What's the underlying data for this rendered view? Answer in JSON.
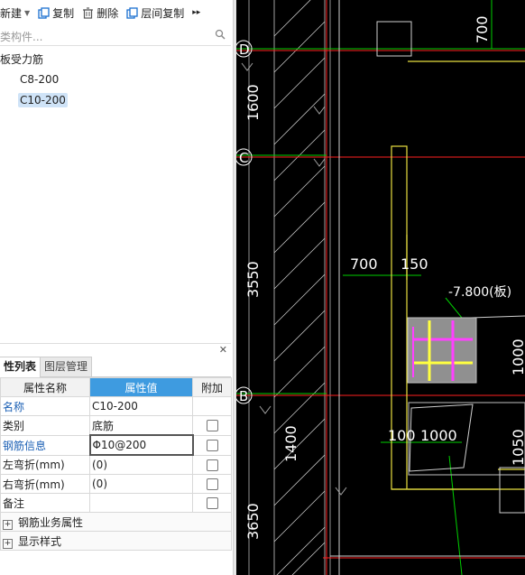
{
  "toolbar": {
    "new_label": "新建",
    "copy_label": "复制",
    "delete_label": "删除",
    "floor_copy_label": "层间复制",
    "more_label": "▸▸"
  },
  "search": {
    "placeholder": "类构件..."
  },
  "tree": {
    "root_label": "板受力筋",
    "items": [
      {
        "label": "C8-200",
        "selected": false
      },
      {
        "label": "C10-200",
        "selected": true
      }
    ]
  },
  "tabs": [
    {
      "label": "性列表",
      "active": true
    },
    {
      "label": "图层管理",
      "active": false
    }
  ],
  "props": {
    "header": {
      "name": "属性名称",
      "value": "属性值",
      "extra": "附加"
    },
    "rows": [
      {
        "name": "名称",
        "value": "C10-200",
        "highlight": true,
        "checkbox": false
      },
      {
        "name": "类别",
        "value": "底筋",
        "highlight": false,
        "checkbox": true
      },
      {
        "name": "钢筋信息",
        "value": "Φ10@200",
        "highlight": true,
        "checkbox": true
      },
      {
        "name": "左弯折(mm)",
        "value": "(0)",
        "highlight": false,
        "checkbox": true
      },
      {
        "name": "右弯折(mm)",
        "value": "(0)",
        "highlight": false,
        "checkbox": true
      },
      {
        "name": "备注",
        "value": "",
        "highlight": false,
        "checkbox": true
      }
    ],
    "groups": [
      "钢筋业务属性",
      "显示样式"
    ]
  },
  "cad": {
    "axes": [
      "D",
      "C",
      "B"
    ],
    "dims_left": [
      "1600",
      "3550",
      "1400",
      "3650"
    ],
    "dims_other": [
      "700",
      "700",
      "150",
      "100",
      "1000",
      "1000",
      "1050"
    ],
    "elevation_label": "-7.800(板)",
    "colors": {
      "background": "#000000",
      "axis": "#ff2020",
      "dimension": "#00d000",
      "wall": "#ffff40",
      "rebar": "#ff40ff",
      "text": "#ffffff"
    }
  }
}
